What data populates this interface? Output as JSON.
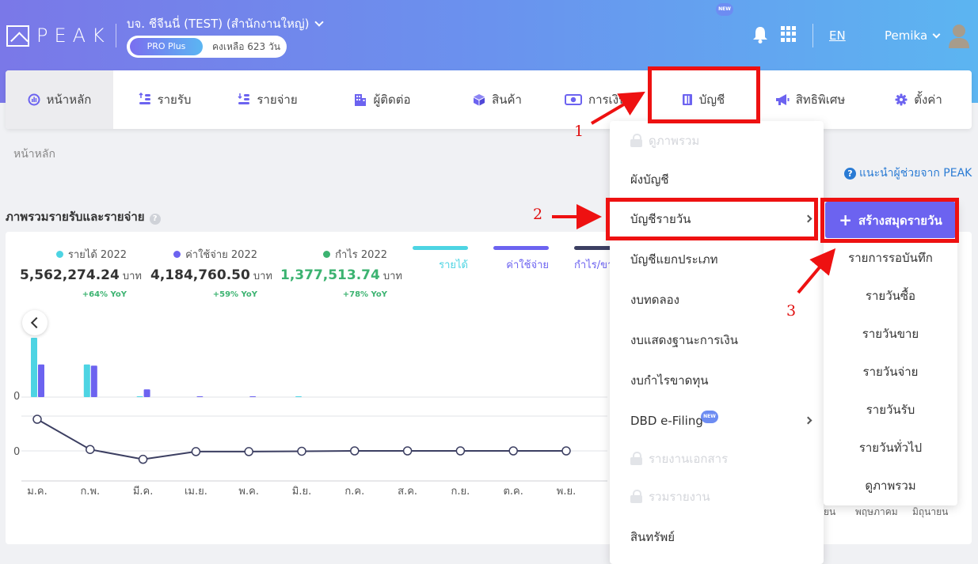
{
  "header": {
    "logo_text": "PEAK",
    "company_name": "บจ. ชีจีนนี่ (TEST) (สำนักงานใหญ่)",
    "plan": "PRO Plus",
    "remaining": "คงเหลือ 623 วัน",
    "language": "EN",
    "user": "Pemika"
  },
  "nav": {
    "items": [
      {
        "label": "หน้าหลัก",
        "icon": "dashboard-icon"
      },
      {
        "label": "รายรับ",
        "icon": "coins-up-icon"
      },
      {
        "label": "รายจ่าย",
        "icon": "coins-down-icon"
      },
      {
        "label": "ผู้ติดต่อ",
        "icon": "building-icon"
      },
      {
        "label": "สินค้า",
        "icon": "box-icon"
      },
      {
        "label": "การเงิน",
        "icon": "money-icon"
      },
      {
        "label": "บัญชี",
        "icon": "ledger-icon"
      },
      {
        "label": "สิทธิพิเศษ",
        "icon": "megaphone-icon"
      },
      {
        "label": "ตั้งค่า",
        "icon": "gear-icon"
      }
    ],
    "new_badge": "NEW"
  },
  "breadcrumb": "หน้าหลัก",
  "help_link": "แนะนำผู้ช่วยจาก PEAK",
  "section_title": "ภาพรวมรายรับและรายจ่าย",
  "stats": [
    {
      "label": "รายได้ 2022",
      "value": "5,562,274.24",
      "unit": "บาท",
      "yoy": "+64% YoY",
      "color": "#4dd4e3"
    },
    {
      "label": "ค่าใช้จ่าย 2022",
      "value": "4,184,760.50",
      "unit": "บาท",
      "yoy": "+59% YoY",
      "color": "#6c63f0"
    },
    {
      "label": "กำไร 2022",
      "value": "1,377,513.74",
      "unit": "บาท",
      "yoy": "+78% YoY",
      "color": "#3cb371"
    }
  ],
  "legend": [
    {
      "label": "รายได้",
      "color": "#4dd4e3"
    },
    {
      "label": "ค่าใช้จ่าย",
      "color": "#6c63f0"
    },
    {
      "label": "กำไร/ขา",
      "color": "#3c3f62"
    }
  ],
  "chart_data": {
    "type": "bar",
    "categories": [
      "ม.ค.",
      "ก.พ.",
      "มี.ค.",
      "เม.ย.",
      "พ.ค.",
      "มิ.ย.",
      "ก.ค.",
      "ส.ค.",
      "ก.ย.",
      "ต.ค.",
      "พ.ย."
    ],
    "series": [
      {
        "name": "รายได้",
        "values": [
          100,
          55,
          1,
          0,
          0,
          1,
          0,
          0,
          0,
          0,
          0
        ]
      },
      {
        "name": "ค่าใช้จ่าย",
        "values": [
          55,
          53,
          13,
          1,
          1,
          0,
          0,
          0,
          0,
          0,
          0
        ]
      },
      {
        "name": "กำไร/ขา",
        "values": [
          45,
          2,
          -12,
          -1,
          -1,
          -0.5,
          0,
          0,
          0,
          0,
          0
        ]
      }
    ],
    "y_tick_label": "0",
    "grid": true
  },
  "dropdown": {
    "items": [
      {
        "label": "ดูภาพรวม",
        "disabled": true
      },
      {
        "label": "ผังบัญชี"
      },
      {
        "label": "บัญชีรายวัน",
        "has_submenu": true
      },
      {
        "label": "บัญชีแยกประเภท"
      },
      {
        "label": "งบทดลอง"
      },
      {
        "label": "งบแสดงฐานะการเงิน"
      },
      {
        "label": "งบกำไรขาดทุน"
      },
      {
        "label": "DBD e-Filing",
        "has_submenu": true,
        "badge": "NEW"
      },
      {
        "label": "รายงานเอกสาร",
        "disabled": true
      },
      {
        "label": "รวมรายงาน",
        "disabled": true
      },
      {
        "label": "สินทรัพย์"
      }
    ]
  },
  "submenu": {
    "create": "สร้างสมุดรายวัน",
    "items": [
      "รายการรอบันทึก",
      "รายวันซื้อ",
      "รายวันขาย",
      "รายวันจ่าย",
      "รายวันรับ",
      "รายวันทั่วไป",
      "ดูภาพรวม"
    ]
  },
  "bg_months": [
    "ยน",
    "พฤษภาคม",
    "มิถุนายน"
  ],
  "annotations": [
    "1",
    "2",
    "3"
  ]
}
